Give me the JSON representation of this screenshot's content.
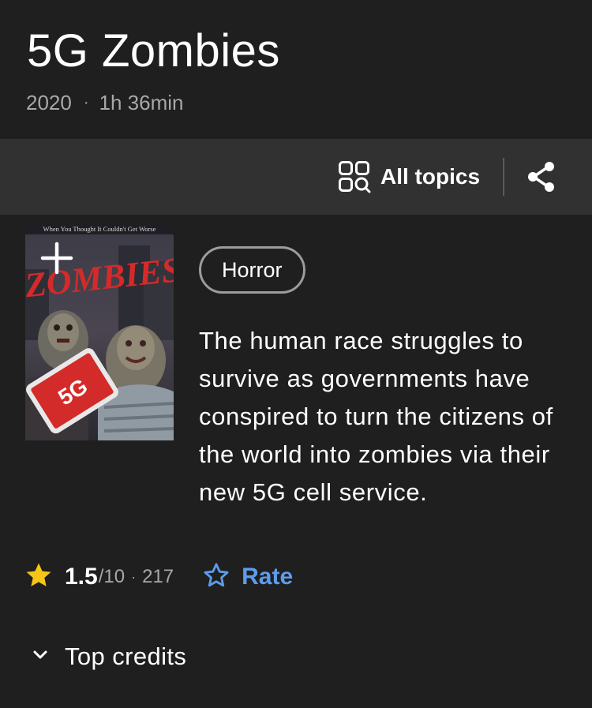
{
  "title": "5G Zombies",
  "meta": {
    "year": "2020",
    "separator": "·",
    "runtime": "1h 36min"
  },
  "toolbar": {
    "all_topics_label": "All topics",
    "all_topics_icon": "grid-search-icon",
    "share_icon": "share-icon"
  },
  "poster": {
    "tagline": "When You Thought It Couldn't Get Worse",
    "title": "ZOMBIES",
    "phone_label": "5G",
    "add_icon": "plus-icon"
  },
  "genre": "Horror",
  "plot": "The human race struggles to survive as governments have conspired to turn the citizens of the world into zombies via their new 5G cell service.",
  "rating": {
    "value": "1.5",
    "scale": "/10",
    "separator": "·",
    "count": "217",
    "star_color": "#f5c518"
  },
  "rate": {
    "label": "Rate",
    "color": "#5d9cec"
  },
  "credits": {
    "label": "Top credits",
    "icon": "chevron-down-icon"
  }
}
